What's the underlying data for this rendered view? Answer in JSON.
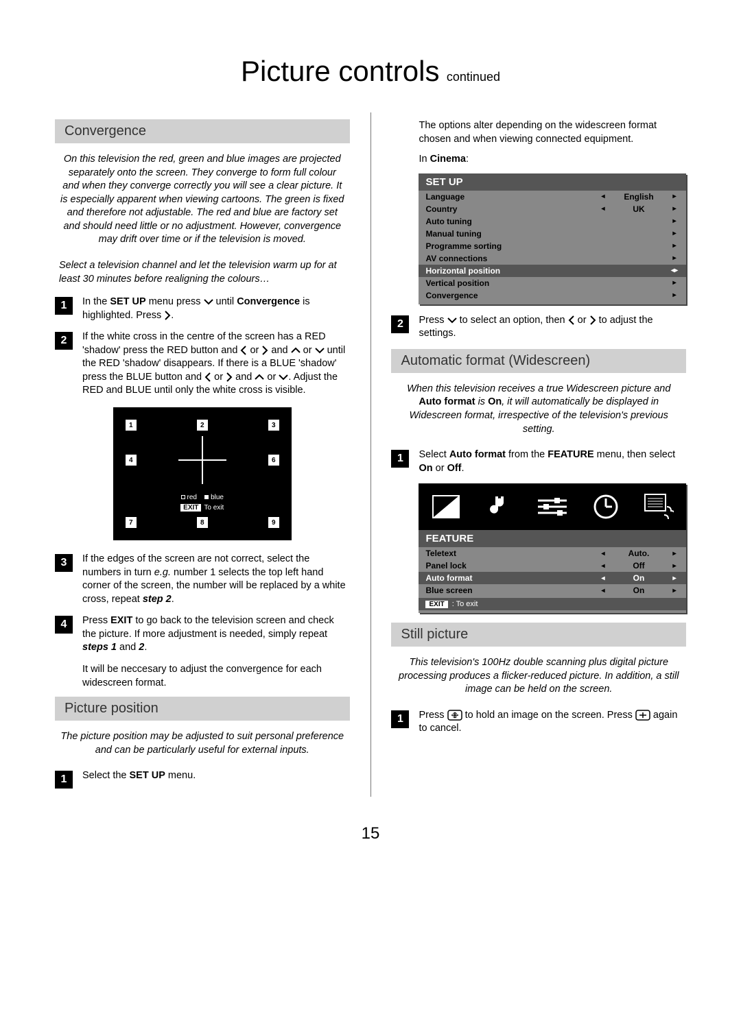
{
  "page": {
    "title_main": "Picture controls",
    "title_sub": "continued",
    "number": "15"
  },
  "left": {
    "convergence": {
      "heading": "Convergence",
      "intro": "On this television the red, green and blue images are projected separately onto the screen. They converge to form full colour and when they converge correctly you will see a clear picture. It is especially apparent when viewing cartoons. The green is fixed and therefore not adjustable. The red and blue are factory set and should need little or no adjustment. However, convergence may drift over time or if the television is moved.",
      "intro2": "Select a television channel and let the television warm up for at least 30 minutes before realigning the colours…",
      "step1a": "In the ",
      "step1b": "SET UP",
      "step1c": " menu press ",
      "step1d": " until ",
      "step1e": "Convergence",
      "step1f": " is highlighted. Press ",
      "step1g": ".",
      "step2a": "If the white cross in the centre of the screen has a RED 'shadow' press the RED button and ",
      "step2b": " or ",
      "step2c": " and ",
      "step2d": " or ",
      "step2e": " until the RED 'shadow' disappears. If there is a BLUE 'shadow' press the BLUE button and ",
      "step2f": " or ",
      "step2g": " and ",
      "step2h": " or ",
      "step2i": ". Adjust the RED and BLUE until only the white cross is visible.",
      "screen": {
        "cells": [
          "1",
          "2",
          "3",
          "4",
          "6",
          "7",
          "8",
          "9"
        ],
        "red": "red",
        "blue": "blue",
        "exit_label": "EXIT",
        "exit_text": "To exit"
      },
      "step3a": "If the edges of the screen are not correct, select the numbers in turn ",
      "step3b": "e.g.",
      "step3c": " number 1 selects the top left hand corner of the screen, the number will be replaced by a white cross, repeat ",
      "step3d": "step 2",
      "step3e": ".",
      "step4a": "Press ",
      "step4b": "EXIT",
      "step4c": " to go back to the television screen and check the picture. If more adjustment is needed, simply repeat ",
      "step4d": "steps 1",
      "step4e": " and ",
      "step4f": "2",
      "step4g": ".",
      "followup": "It will be neccesary to adjust the convergence for each widescreen format."
    },
    "position": {
      "heading": "Picture position",
      "intro": "The picture position may be adjusted to suit personal preference and can be particularly useful for external inputs.",
      "step1a": "Select the ",
      "step1b": "SET UP",
      "step1c": " menu."
    }
  },
  "right": {
    "position_cont": {
      "para": "The options alter depending on the widescreen format chosen and when viewing connected equipment.",
      "in_cinema_a": "In ",
      "in_cinema_b": "Cinema",
      "in_cinema_c": ":",
      "setup_menu": {
        "title": "SET UP",
        "rows": [
          {
            "label": "Language",
            "l": "◂",
            "val": "English",
            "r": "▸"
          },
          {
            "label": "Country",
            "l": "◂",
            "val": "UK",
            "r": "▸"
          },
          {
            "label": "Auto tuning",
            "l": "",
            "val": "",
            "r": "▸"
          },
          {
            "label": "Manual tuning",
            "l": "",
            "val": "",
            "r": "▸"
          },
          {
            "label": "Programme sorting",
            "l": "",
            "val": "",
            "r": "▸"
          },
          {
            "label": "AV connections",
            "l": "",
            "val": "",
            "r": "▸"
          },
          {
            "label": "Horizontal position",
            "l": "",
            "val": "",
            "r": "◂▸",
            "hl": true
          },
          {
            "label": "Vertical position",
            "l": "",
            "val": "",
            "r": "▸"
          },
          {
            "label": "Convergence",
            "l": "",
            "val": "",
            "r": "▸"
          }
        ]
      },
      "step2a": "Press ",
      "step2b": " to select an option, then ",
      "step2c": " or ",
      "step2d": " to adjust the settings."
    },
    "auto_format": {
      "heading": "Automatic format (Widescreen)",
      "intro_a": "When this television receives a true Widescreen picture and ",
      "intro_b": "Auto format",
      "intro_c": " is ",
      "intro_d": "On",
      "intro_e": ", it will automatically be displayed in Widescreen format, irrespective of the television's previous setting.",
      "step1a": "Select ",
      "step1b": "Auto format",
      "step1c": " from the ",
      "step1d": "FEATURE",
      "step1e": " menu, then select ",
      "step1f": "On",
      "step1g": " or ",
      "step1h": "Off",
      "step1i": ".",
      "feature_menu": {
        "title": "FEATURE",
        "rows": [
          {
            "label": "Teletext",
            "l": "◂",
            "val": "Auto.",
            "r": "▸"
          },
          {
            "label": "Panel lock",
            "l": "◂",
            "val": "Off",
            "r": "▸"
          },
          {
            "label": "Auto format",
            "l": "◂",
            "val": "On",
            "r": "▸",
            "hl": true
          },
          {
            "label": "Blue screen",
            "l": "◂",
            "val": "On",
            "r": "▸"
          }
        ],
        "exit_label": "EXIT",
        "exit_text": ": To exit"
      }
    },
    "still": {
      "heading": "Still picture",
      "intro": "This television's 100Hz double scanning plus digital picture processing produces a flicker-reduced picture. In addition, a still image can be held on the screen.",
      "step1a": "Press ",
      "step1b": " to hold an image on the screen. Press ",
      "step1c": " again to cancel."
    }
  }
}
